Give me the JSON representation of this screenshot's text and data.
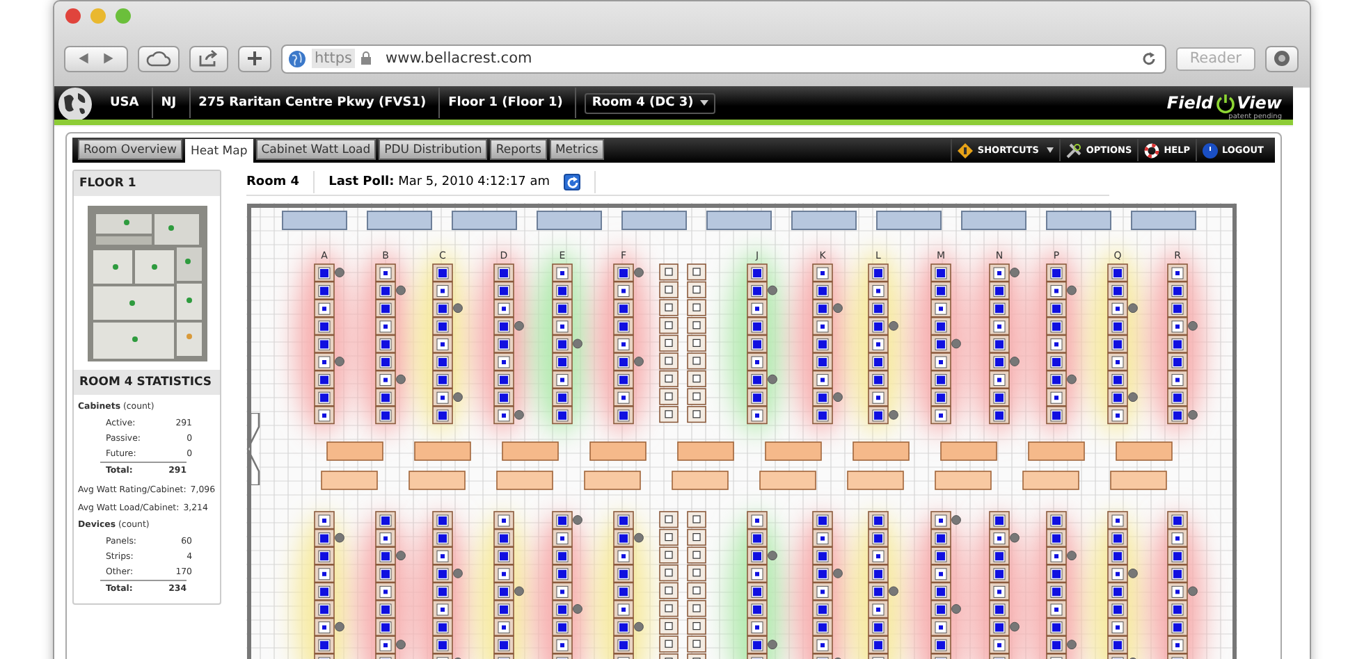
{
  "browser": {
    "scheme": "https",
    "url": "www.bellacrest.com",
    "reader": "Reader"
  },
  "breadcrumb": [
    {
      "label": "USA",
      "kind": "crumb"
    },
    {
      "label": "NJ",
      "kind": "crumb"
    },
    {
      "label": "275 Raritan Centre Pkwy (FVS1)",
      "kind": "crumb"
    },
    {
      "label": "Floor 1 (Floor 1)",
      "kind": "crumb"
    },
    {
      "label": "Room 4 (DC 3)",
      "kind": "dropdown"
    }
  ],
  "logo": {
    "left": "Field",
    "right": "View",
    "tagline": "patent pending"
  },
  "tabs": [
    {
      "label": "Room Overview",
      "selected": false
    },
    {
      "label": "Heat Map",
      "selected": true
    },
    {
      "label": "Cabinet Watt Load",
      "selected": false
    },
    {
      "label": "PDU Distribution",
      "selected": false
    },
    {
      "label": "Reports",
      "selected": false
    },
    {
      "label": "Metrics",
      "selected": false
    }
  ],
  "toolbar": [
    {
      "label": "SHORTCUTS",
      "kind": "shortcuts"
    },
    {
      "label": "OPTIONS",
      "kind": "options"
    },
    {
      "label": "HELP",
      "kind": "help"
    },
    {
      "label": "LOGOUT",
      "kind": "logout"
    }
  ],
  "sidebar": {
    "floor_title": "FLOOR 1",
    "stats_title": "ROOM 4 STATISTICS",
    "sections": [
      {
        "kind": "group",
        "heading": "Cabinets",
        "unit": "(count)",
        "rows": [
          {
            "label": "Active:",
            "value": "291",
            "total": false
          },
          {
            "label": "Passive:",
            "value": "0",
            "total": false
          },
          {
            "label": "Future:",
            "value": "0",
            "total": false
          },
          {
            "label": "Total:",
            "value": "291",
            "total": true
          }
        ]
      },
      {
        "kind": "line",
        "label": "Avg Watt Rating/Cabinet:",
        "value": "7,096"
      },
      {
        "kind": "line",
        "label": "Avg Watt Load/Cabinet:",
        "value": "3,214"
      },
      {
        "kind": "group",
        "heading": "Devices",
        "unit": "(count)",
        "rows": [
          {
            "label": "Panels:",
            "value": "60",
            "total": false
          },
          {
            "label": "Strips:",
            "value": "4",
            "total": false
          },
          {
            "label": "Other:",
            "value": "170",
            "total": false
          },
          {
            "label": "Total:",
            "value": "234",
            "total": true
          }
        ]
      }
    ]
  },
  "map_header": {
    "room": "Room 4",
    "poll_label": "Last Poll:",
    "poll_value": "Mar 5, 2010 4:12:17 am"
  },
  "heat_map": {
    "upper_columns": [
      {
        "letter": "A",
        "color": "#f7b0b0"
      },
      {
        "letter": "B",
        "color": "#f7b0b0"
      },
      {
        "letter": "C",
        "color": "#f7eaa0"
      },
      {
        "letter": "D",
        "color": "#f7b0b0"
      },
      {
        "letter": "E",
        "color": "#b4eab0"
      },
      {
        "letter": "F",
        "color": "#f7b0b0"
      },
      {
        "letter": "J",
        "color": "#b4eab0"
      },
      {
        "letter": "K",
        "color": "#f7b0b0"
      },
      {
        "letter": "L",
        "color": "#f7eaa0"
      },
      {
        "letter": "M",
        "color": "#f7b0b0"
      },
      {
        "letter": "N",
        "color": "#f7b0b0"
      },
      {
        "letter": "P",
        "color": "#f7b0b0"
      },
      {
        "letter": "Q",
        "color": "#f7eaa0"
      },
      {
        "letter": "R",
        "color": "#f7b0b0"
      }
    ],
    "lower_columns": [
      {
        "color": "#f7eaa0"
      },
      {
        "color": "#f7b0b0"
      },
      {
        "color": "#f7b0b0"
      },
      {
        "color": "#f7eaa0"
      },
      {
        "color": "#f7b0b0"
      },
      {
        "color": "#f7eaa0"
      },
      {
        "color": "#b4eab0"
      },
      {
        "color": "#f7b0b0"
      },
      {
        "color": "#f7eaa0"
      },
      {
        "color": "#f7b0b0"
      },
      {
        "color": "#f7b0b0"
      },
      {
        "color": "#f7b0b0"
      },
      {
        "color": "#f7eaa0"
      },
      {
        "color": "#f7b0b0"
      }
    ]
  }
}
